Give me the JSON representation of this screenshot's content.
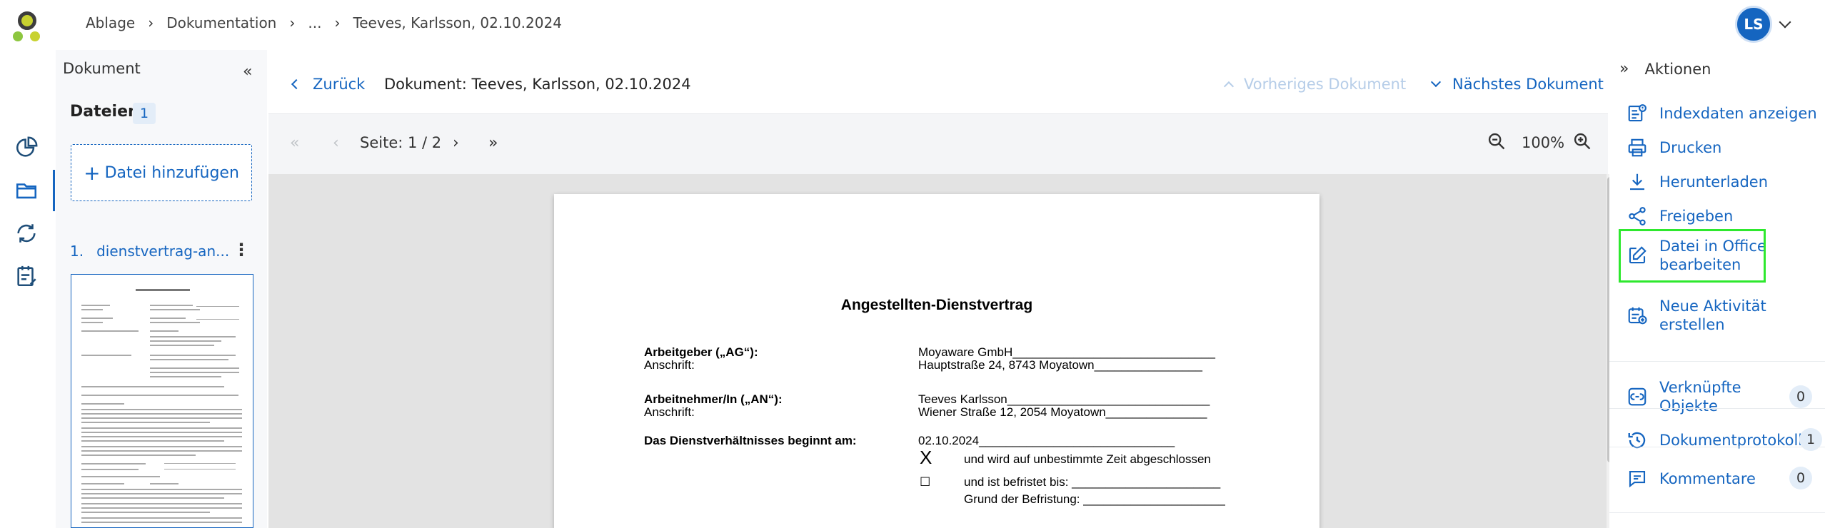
{
  "breadcrumb": {
    "items": [
      "Ablage",
      "Dokumentation",
      "...",
      "Teeves, Karlsson, 02.10.2024"
    ]
  },
  "user": {
    "initials": "LS"
  },
  "document_panel": {
    "title": "Dokument",
    "files_label": "Dateien",
    "files_count": "1",
    "add_file_label": "Datei hinzufügen",
    "file_number": "1.",
    "file_name": "dienstvertrag-an..."
  },
  "viewer": {
    "back_label": "Zurück",
    "document_title": "Dokument: Teeves, Karlsson, 02.10.2024",
    "prev_label": "Vorheriges Dokument",
    "next_label": "Nächstes Dokument",
    "page_label": "Seite: 1 / 2",
    "zoom_label": "100%"
  },
  "page_content": {
    "heading": "Angestellten-Dienstvertrag",
    "employer_label": "Arbeitgeber („AG“):",
    "employer_value": "Moyaware GmbH______________________________",
    "address_label": "Anschrift:",
    "employer_address": "Hauptstraße 24, 8743 Moyatown________________",
    "employee_label": "Arbeitnehmer/In („AN“):",
    "employee_value": "Teeves Karlsson______________________________",
    "employee_address": "Wiener Straße 12, 2054 Moyatown_______________",
    "start_label": "Das Dienstverhältnisses beginnt am:",
    "start_value": "02.10.2024_____________________________",
    "check_x": "X",
    "option_unlimited": "und wird auf unbestimmte Zeit abgeschlossen",
    "check_empty": "☐",
    "option_limited": "und ist befristet bis: ______________________",
    "reason": "Grund der Befristung: _____________________"
  },
  "actions": {
    "title": "Aktionen",
    "items": [
      {
        "label": "Indexdaten anzeigen",
        "icon": "index-data-icon"
      },
      {
        "label": "Drucken",
        "icon": "printer-icon"
      },
      {
        "label": "Herunterladen",
        "icon": "download-icon"
      },
      {
        "label": "Freigeben",
        "icon": "share-icon"
      },
      {
        "label_line1": "Datei in Office",
        "label_line2": "bearbeiten",
        "icon": "edit-icon"
      },
      {
        "label_line1": "Neue Aktivität",
        "label_line2": "erstellen",
        "icon": "new-activity-icon"
      }
    ],
    "linked_line1": "Verknüpfte",
    "linked_line2": "Objekte",
    "linked_count": "0",
    "protocol_label": "Dokumentprotokoll",
    "protocol_count": "1",
    "comments_label": "Kommentare",
    "comments_count": "0"
  },
  "colors": {
    "accent": "#1565c0",
    "highlight": "#2ee82e",
    "logo_green": "#8dc63f",
    "logo_dark": "#3d3d3d"
  }
}
